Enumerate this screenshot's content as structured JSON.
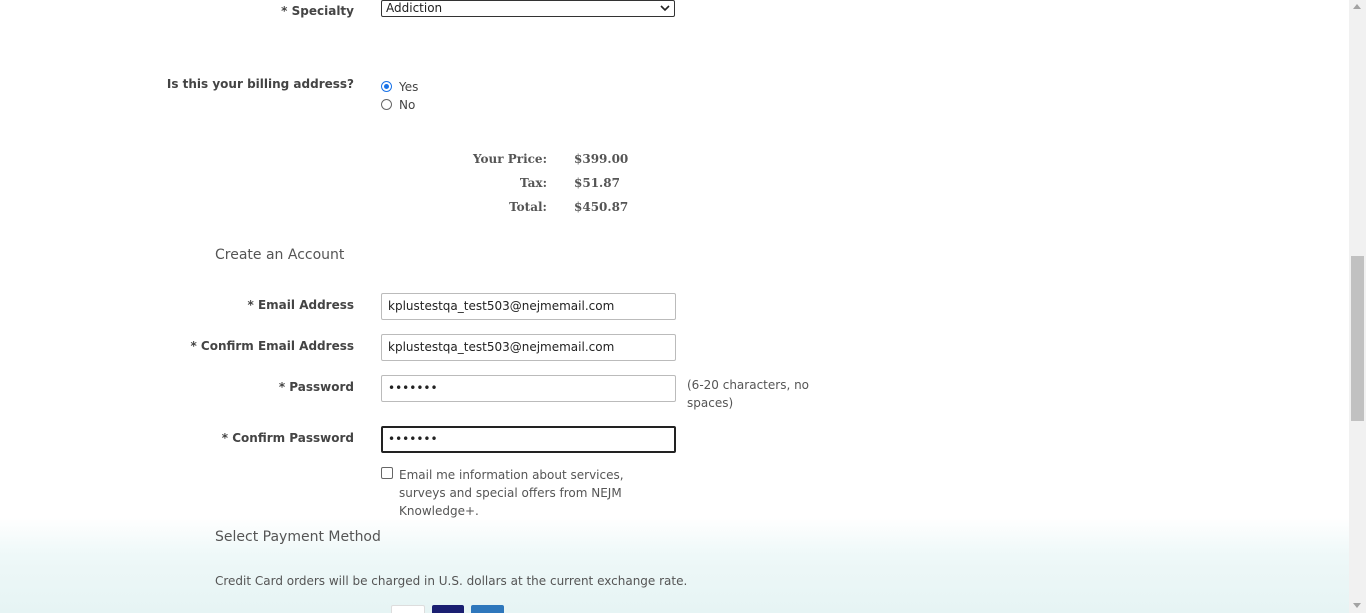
{
  "specialty": {
    "label": "* Specialty",
    "value": "Addiction"
  },
  "billing": {
    "question": "Is this your billing address?",
    "options": [
      {
        "label": "Yes",
        "checked": true
      },
      {
        "label": "No",
        "checked": false
      }
    ]
  },
  "pricing": {
    "your_price_label": "Your Price:",
    "your_price_value": "$399.00",
    "tax_label": "Tax:",
    "tax_value": "$51.87",
    "total_label": "Total:",
    "total_value": "$450.87"
  },
  "account": {
    "title": "Create an Account",
    "email_label": "* Email Address",
    "email_value": "kplustestqa_test503@nejmemail.com",
    "confirm_email_label": "* Confirm Email Address",
    "confirm_email_value": "kplustestqa_test503@nejmemail.com",
    "password_label": "* Password",
    "password_value": "•••••••",
    "password_hint": "(6-20 characters, no spaces)",
    "confirm_password_label": "* Confirm Password",
    "confirm_password_value": "•••••••",
    "newsletter_label": "Email me information about services, surveys and special offers from NEJM Knowledge+.",
    "newsletter_checked": false
  },
  "payment": {
    "title": "Select Payment Method",
    "note": "Credit Card orders will be charged in U.S. dollars at the current exchange rate.",
    "cards": [
      "mastercard-icon",
      "visa-icon",
      "amex-icon"
    ]
  },
  "colors": {
    "radio_accent": "#1a73e8",
    "band": "#e6f4f4"
  }
}
